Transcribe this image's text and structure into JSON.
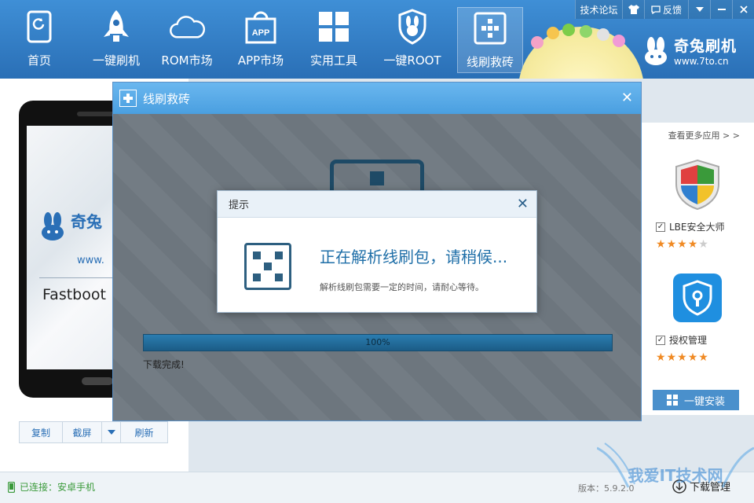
{
  "nav": [
    {
      "label": "首页",
      "icon": "home-icon"
    },
    {
      "label": "一键刷机",
      "icon": "rocket-icon"
    },
    {
      "label": "ROM市场",
      "icon": "cloud-icon"
    },
    {
      "label": "APP市场",
      "icon": "app-bag-icon"
    },
    {
      "label": "实用工具",
      "icon": "grid-tools-icon"
    },
    {
      "label": "一键ROOT",
      "icon": "bunny-shield-icon"
    },
    {
      "label": "线刷救砖",
      "icon": "flash-brick-icon",
      "active": true
    }
  ],
  "tools": {
    "forum": "技术论坛",
    "feedback": "反馈"
  },
  "logo": {
    "brand": "奇兔刷机",
    "url": "www.7to.cn"
  },
  "phone": {
    "brand": "奇兔",
    "url": "www.",
    "mode": "Fastboot"
  },
  "phone_actions": {
    "copy": "复制",
    "screenshot": "截屏",
    "refresh": "刷新"
  },
  "right_panel": {
    "more": "查看更多应用 > >",
    "apps": [
      {
        "name": "LBE安全大师",
        "checked": true,
        "rating": 4
      },
      {
        "name": "授权管理",
        "checked": true,
        "rating": 5
      }
    ],
    "install": "一键安装"
  },
  "status": {
    "connection": "已连接：安卓手机",
    "version": "版本：5.9.2.0",
    "download_manager": "下载管理"
  },
  "flash_dialog": {
    "title": "线刷救砖",
    "progress": 100,
    "progress_text": "100%",
    "download_status": "下载完成!"
  },
  "prompt": {
    "title": "提示",
    "message": "正在解析线刷包，请稍候...",
    "detail": "解析线刷包需要一定的时间，请耐心等待。"
  },
  "watermark": "我爱IT技术网",
  "colors": {
    "topbar": "#2a6fb6",
    "accent": "#1f6fa8",
    "star": "#f08a24",
    "connected": "#3a9a3a"
  }
}
